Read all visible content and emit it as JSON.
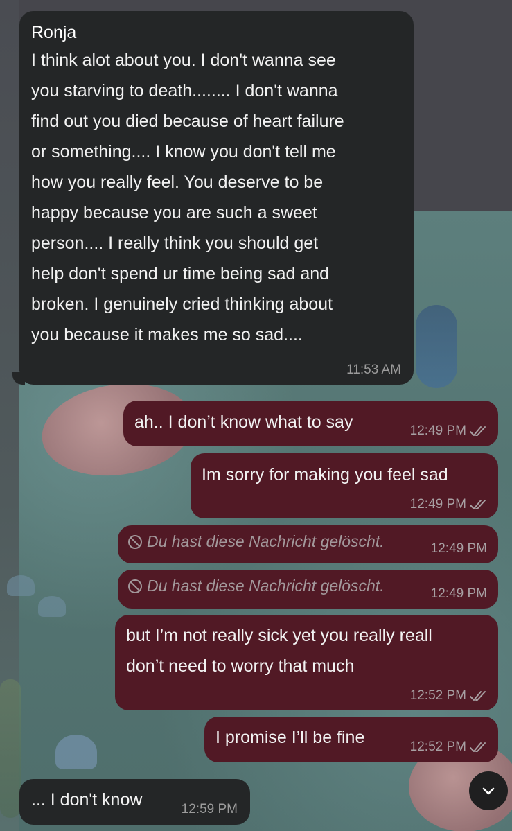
{
  "messages": [
    {
      "direction": "incoming",
      "sender": "Ronja",
      "text": "I think alot about you. I don't wanna see\nyou starving to death........ I don't wanna\nfind out you died because of heart failure\nor something.... I know you don't tell me\nhow you really feel. You deserve to be\nhappy because you are such a sweet\nperson.... I really think you should get\nhelp don't spend ur time being sad and\nbroken. I genuinely cried thinking about\nyou because it makes me so sad....",
      "time": "11:53 AM"
    },
    {
      "direction": "outgoing",
      "text": "ah.. I don’t know what to say",
      "time": "12:49 PM",
      "status": "read"
    },
    {
      "direction": "outgoing",
      "text": "Im sorry for making you feel sad",
      "time": "12:49 PM",
      "status": "read"
    },
    {
      "direction": "outgoing",
      "deleted": true,
      "text": "Du hast diese Nachricht gelöscht.",
      "time": "12:49 PM"
    },
    {
      "direction": "outgoing",
      "deleted": true,
      "text": "Du hast diese Nachricht gelöscht.",
      "time": "12:49 PM"
    },
    {
      "direction": "outgoing",
      "text": "but I’m not really sick yet you really reall\ndon’t need to worry that much",
      "time": "12:52 PM",
      "status": "read"
    },
    {
      "direction": "outgoing",
      "text": "I promise I’ll be fine",
      "time": "12:52 PM",
      "status": "read"
    },
    {
      "direction": "incoming",
      "text": "... I don't know",
      "time": "12:59 PM"
    }
  ],
  "icons": {
    "read_receipt": "double-check-icon",
    "deleted": "ban-icon",
    "scroll_down": "chevron-down-icon"
  },
  "colors": {
    "incoming_bubble": "#242627",
    "outgoing_bubble": "#511925"
  }
}
